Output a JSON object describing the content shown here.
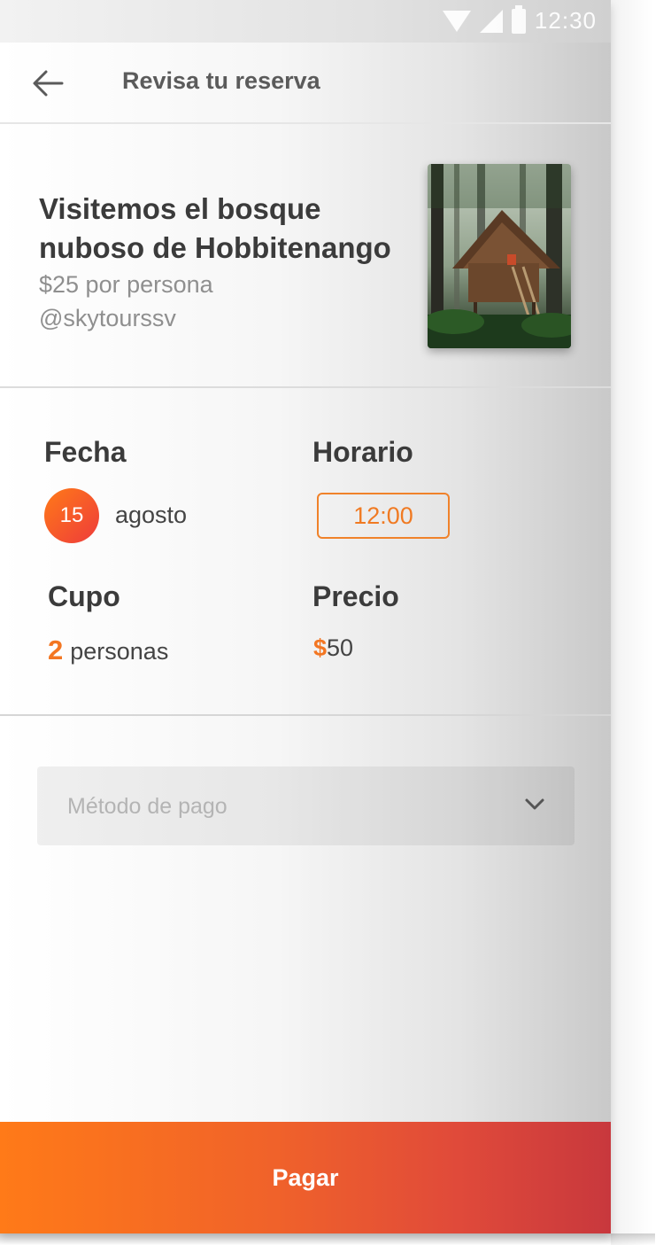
{
  "status_bar": {
    "time": "12:30",
    "icons": [
      "wifi-icon",
      "signal-icon",
      "battery-icon"
    ]
  },
  "header": {
    "back_icon": "arrow-left-icon",
    "title": "Revisa tu reserva"
  },
  "tour": {
    "title": "Visitemos el bosque nuboso de Hobbitenango",
    "price_text": "$25 por persona",
    "handle": "@skytourssv"
  },
  "details": {
    "fecha_label": "Fecha",
    "date_day": "15",
    "date_month": "agosto",
    "horario_label": "Horario",
    "time": "12:00",
    "cupo_label": "Cupo",
    "cupo_count": "2",
    "cupo_unit": "personas",
    "precio_label": "Precio",
    "price_currency": "$",
    "price_amount": "50"
  },
  "payment": {
    "placeholder": "Método de pago",
    "chevron_icon": "chevron-down-icon"
  },
  "footer": {
    "pay_label": "Pagar"
  },
  "colors": {
    "accent": "#f37622",
    "gradient_start": "#ff7a18",
    "gradient_end": "#c8383d"
  }
}
